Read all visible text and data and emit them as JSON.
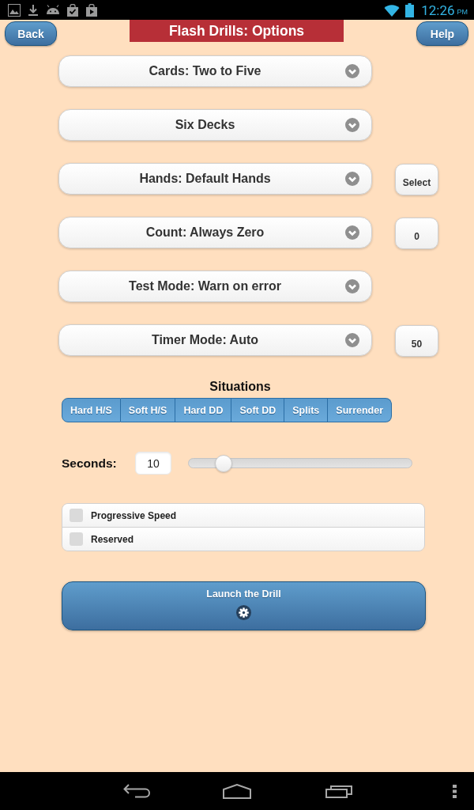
{
  "status_bar": {
    "time": "12:26",
    "period": "PM"
  },
  "header": {
    "back_button": "Back",
    "title": "Flash Drills: Options",
    "help_button": "Help"
  },
  "options": [
    {
      "label": "Cards: Two to Five"
    },
    {
      "label": "Six Decks"
    },
    {
      "label": "Hands: Default Hands",
      "side_button": "Select"
    },
    {
      "label": "Count: Always Zero",
      "side_button": "0"
    },
    {
      "label": "Test Mode: Warn on error"
    },
    {
      "label": "Timer Mode: Auto",
      "side_button": "50"
    }
  ],
  "situations": {
    "title": "Situations",
    "items": [
      {
        "label": "Hard H/S",
        "checked": true
      },
      {
        "label": "Soft H/S",
        "checked": true
      },
      {
        "label": "Hard DD",
        "checked": true
      },
      {
        "label": "Soft DD",
        "checked": true
      },
      {
        "label": "Splits",
        "checked": true
      },
      {
        "label": "Surrender",
        "checked": true
      }
    ]
  },
  "seconds": {
    "label": "Seconds:",
    "value": "10",
    "level": 0.13
  },
  "toggles": [
    {
      "label": "Progressive Speed",
      "checked": false
    },
    {
      "label": "Reserved",
      "checked": false
    }
  ],
  "launch_button": {
    "label": "Launch the Drill"
  }
}
